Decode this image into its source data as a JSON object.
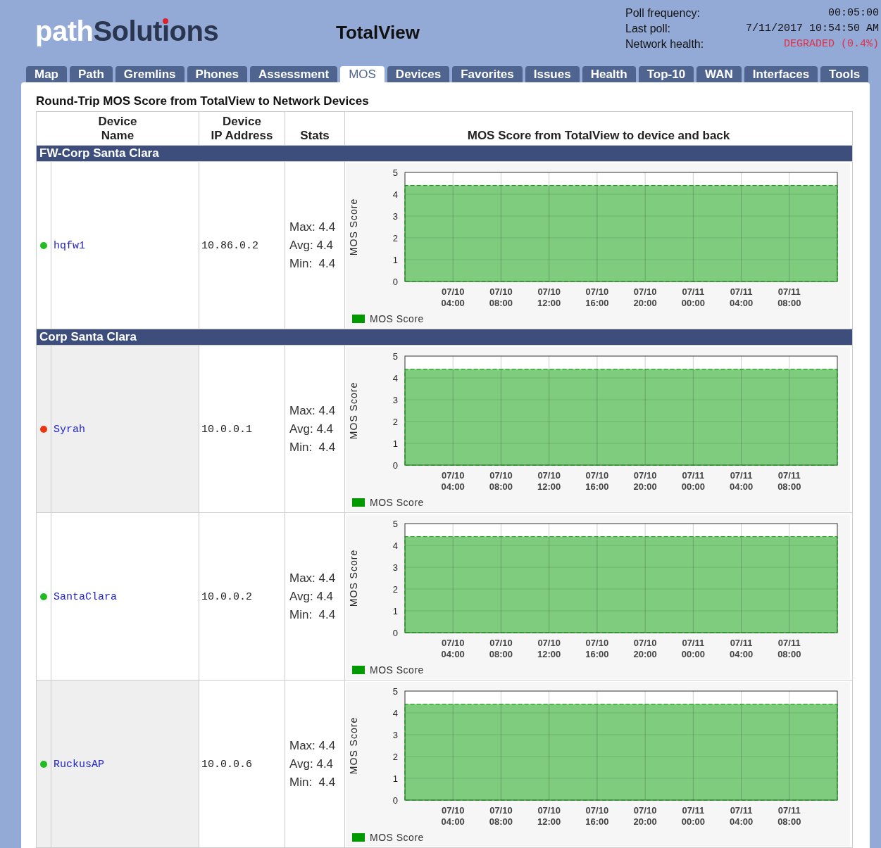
{
  "header": {
    "logo": {
      "part_1": "path",
      "part_2": "Solutions"
    },
    "product": "TotalView",
    "status": [
      {
        "kind": "plain",
        "label": "Poll frequency:",
        "value": "00:05:00"
      },
      {
        "kind": "plain",
        "label": "Last poll:",
        "value": "7/11/2017 10:54:50 AM"
      },
      {
        "kind": "alert",
        "label": "Network health:",
        "value": "DEGRADED (0.4%)"
      }
    ]
  },
  "tabs": [
    {
      "label": "Map",
      "selected": false
    },
    {
      "label": "Path",
      "selected": false
    },
    {
      "label": "Gremlins",
      "selected": false
    },
    {
      "label": "Phones",
      "selected": false
    },
    {
      "label": "Assessment",
      "selected": false
    },
    {
      "label": "MOS",
      "selected": true
    },
    {
      "label": "Devices",
      "selected": false
    },
    {
      "label": "Favorites",
      "selected": false
    },
    {
      "label": "Issues",
      "selected": false
    },
    {
      "label": "Health",
      "selected": false
    },
    {
      "label": "Top-10",
      "selected": false
    },
    {
      "label": "WAN",
      "selected": false
    },
    {
      "label": "Interfaces",
      "selected": false
    },
    {
      "label": "Tools",
      "selected": false
    }
  ],
  "title": "Round-Trip MOS Score from TotalView to Network Devices",
  "table": {
    "columns": [
      "Device\nName",
      "Device\nIP Address",
      "Stats",
      "MOS Score from TotalView to device and back"
    ],
    "groups": [
      {
        "name": "FW-Corp Santa Clara",
        "devices": [
          {
            "color": "#22bb22",
            "name": "hqfw1",
            "ip": "10.86.0.2",
            "stats": [
              "Max: 4.4",
              "Avg: 4.4",
              "Min:  4.4"
            ],
            "chart_data": {
              "type": "area",
              "grid": true,
              "ylabel": "MOS Score",
              "ylim": [
                0,
                5
              ],
              "yticks": [
                0,
                1,
                2,
                3,
                4,
                5
              ],
              "categories": [
                null,
                "07/10\n04:00",
                "07/10\n08:00",
                "07/10\n12:00",
                "07/10\n16:00",
                "07/10\n20:00",
                "07/11\n00:00",
                "07/11\n04:00",
                "07/11\n08:00",
                null
              ],
              "series": [
                {
                  "name": "MOS Score",
                  "color": "#009900",
                  "values": [
                    4.4,
                    4.4,
                    4.4,
                    4.4,
                    4.4,
                    4.4,
                    4.4,
                    4.4,
                    4.4,
                    4.4
                  ]
                }
              ]
            }
          }
        ]
      },
      {
        "name": "Corp Santa Clara",
        "devices": [
          {
            "color": "#ee3311",
            "name": "Syrah",
            "ip": "10.0.0.1",
            "stats": [
              "Max: 4.4",
              "Avg: 4.4",
              "Min:  4.4"
            ],
            "chart_data": {
              "type": "area",
              "grid": true,
              "ylabel": "MOS Score",
              "ylim": [
                0,
                5
              ],
              "yticks": [
                0,
                1,
                2,
                3,
                4,
                5
              ],
              "categories": [
                null,
                "07/10\n04:00",
                "07/10\n08:00",
                "07/10\n12:00",
                "07/10\n16:00",
                "07/10\n20:00",
                "07/11\n00:00",
                "07/11\n04:00",
                "07/11\n08:00",
                null
              ],
              "series": [
                {
                  "name": "MOS Score",
                  "color": "#009900",
                  "values": [
                    4.4,
                    4.4,
                    4.4,
                    4.4,
                    4.4,
                    4.4,
                    4.4,
                    4.4,
                    4.4,
                    4.4
                  ]
                }
              ]
            }
          },
          {
            "color": "#22bb22",
            "name": "SantaClara",
            "ip": "10.0.0.2",
            "stats": [
              "Max: 4.4",
              "Avg: 4.4",
              "Min:  4.4"
            ],
            "chart_data": {
              "type": "area",
              "grid": true,
              "ylabel": "MOS Score",
              "ylim": [
                0,
                5
              ],
              "yticks": [
                0,
                1,
                2,
                3,
                4,
                5
              ],
              "categories": [
                null,
                "07/10\n04:00",
                "07/10\n08:00",
                "07/10\n12:00",
                "07/10\n16:00",
                "07/10\n20:00",
                "07/11\n00:00",
                "07/11\n04:00",
                "07/11\n08:00",
                null
              ],
              "series": [
                {
                  "name": "MOS Score",
                  "color": "#009900",
                  "values": [
                    4.4,
                    4.4,
                    4.4,
                    4.4,
                    4.4,
                    4.4,
                    4.4,
                    4.4,
                    4.4,
                    4.4
                  ]
                }
              ]
            }
          },
          {
            "color": "#22bb22",
            "name": "RuckusAP",
            "ip": "10.0.0.6",
            "stats": [
              "Max: 4.4",
              "Avg: 4.4",
              "Min:  4.4"
            ],
            "chart_data": {
              "type": "area",
              "grid": true,
              "ylabel": "MOS Score",
              "ylim": [
                0,
                5
              ],
              "yticks": [
                0,
                1,
                2,
                3,
                4,
                5
              ],
              "categories": [
                null,
                "07/10\n04:00",
                "07/10\n08:00",
                "07/10\n12:00",
                "07/10\n16:00",
                "07/10\n20:00",
                "07/11\n00:00",
                "07/11\n04:00",
                "07/11\n08:00",
                null
              ],
              "series": [
                {
                  "name": "MOS Score",
                  "color": "#009900",
                  "values": [
                    4.4,
                    4.4,
                    4.4,
                    4.4,
                    4.4,
                    4.4,
                    4.4,
                    4.4,
                    4.4,
                    4.4
                  ]
                }
              ]
            }
          }
        ]
      }
    ]
  }
}
